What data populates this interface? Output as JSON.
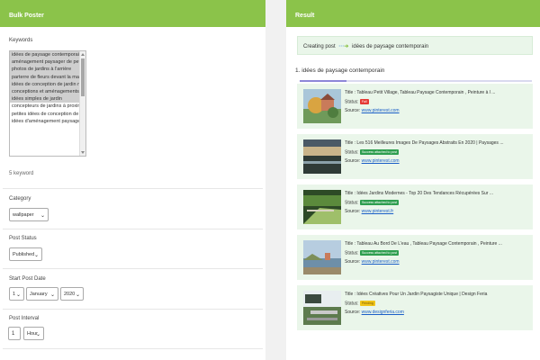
{
  "left_panel": {
    "title": "Bulk Poster",
    "keywords_label": "Keywords",
    "keywords": [
      {
        "text": "idées de paysage contemporain",
        "selected": true
      },
      {
        "text": "aménagement paysager de petite",
        "selected": true
      },
      {
        "text": "photos de jardins à l'arrière",
        "selected": true
      },
      {
        "text": "parterre de fleurs devant la maison",
        "selected": true
      },
      {
        "text": "idées de conception de jardin moderne",
        "selected": true
      },
      {
        "text": "conceptions et aménagements de",
        "selected": true
      },
      {
        "text": "idées simples de jardin",
        "selected": true
      },
      {
        "text": "concepteurs de jardins à proximité",
        "selected": false
      },
      {
        "text": "petites idées de conception de jardin",
        "selected": false
      },
      {
        "text": "idées d'aménagement paysager à",
        "selected": false
      }
    ],
    "keyword_count": "5 keyword",
    "category_label": "Category",
    "category_value": "wallpaper",
    "post_status_label": "Post Status",
    "post_status_value": "Published",
    "start_date_label": "Start Post Date",
    "start_day": "1",
    "start_month": "January",
    "start_year": "2020",
    "interval_label": "Post Interval",
    "interval_value": "1",
    "interval_unit": "Hour"
  },
  "right_panel": {
    "title": "Result",
    "creating_label": "Creating post",
    "creating_keyword": "idées de paysage contemporain",
    "keyword_heading": "1. idées de paysage contemporain",
    "progress": 0.2,
    "status_label": "Status:",
    "source_label": "Source:",
    "results": [
      {
        "title": "Title : Tableau Petit Village, Tableau Paysage Contemporain , Peinture à l ...",
        "status": "Fail",
        "status_color": "#e53935",
        "source": "www.pinterest.com"
      },
      {
        "title": "Title : Les 516 Meilleures Images De Paysages Abstraits En 2020 | Paysages ...",
        "status": "Success attached to post",
        "status_color": "#2e9e4f",
        "source": "www.pinterest.com"
      },
      {
        "title": "Title : Idées Jardins Modernes - Top 20 Des Tendances Récupérées Sur ...",
        "status": "Success attached to post",
        "status_color": "#2e9e4f",
        "source": "www.pinterest.fr"
      },
      {
        "title": "Title : Tableau Au Bord De L'eau , Tableau Paysage Contemporain , Peinture ...",
        "status": "Success attached to post",
        "status_color": "#2e9e4f",
        "source": "www.pinterest.com"
      },
      {
        "title": "Title : Idées Créatives Pour Un Jardin Paysagiste Unique | Design Feria",
        "status": "Pending",
        "status_color": "#f0c419",
        "source": "www.designferia.com"
      }
    ]
  }
}
